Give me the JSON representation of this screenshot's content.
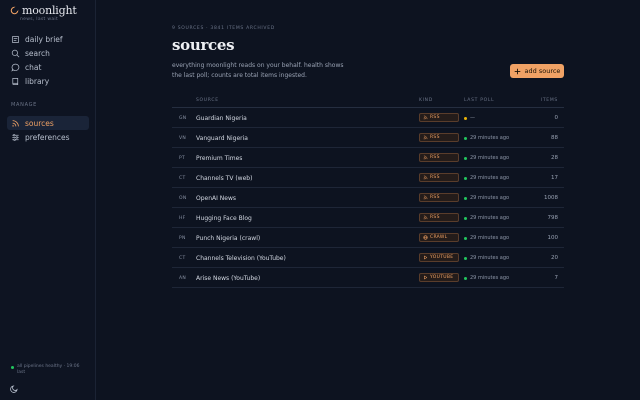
{
  "brand": {
    "name": "moonlight",
    "tagline": "news, last wait"
  },
  "nav": [
    {
      "label": "daily brief",
      "icon": "document-icon",
      "name": "daily-brief"
    },
    {
      "label": "search",
      "icon": "search-icon",
      "name": "search"
    },
    {
      "label": "chat",
      "icon": "chat-icon",
      "name": "chat"
    },
    {
      "label": "library",
      "icon": "book-icon",
      "name": "library"
    }
  ],
  "manage": {
    "label": "MANAGE",
    "items": [
      {
        "label": "sources",
        "icon": "rss-icon",
        "name": "sources",
        "active": true
      },
      {
        "label": "preferences",
        "icon": "sliders-icon",
        "name": "preferences",
        "active": false
      }
    ]
  },
  "status": {
    "text": "all pipelines healthy · 19:06 last"
  },
  "page": {
    "crumb": "9 SOURCES · 3841 ITEMS ARCHIVED",
    "title": "sources",
    "description": "everything moonlight reads on your behalf. health shows the last poll; counts are total items ingested.",
    "add_label": "add source"
  },
  "table": {
    "columns": {
      "source": "SOURCE",
      "kind": "KIND",
      "last_poll": "LAST POLL",
      "items": "ITEMS"
    },
    "rows": [
      {
        "abbr": "GN",
        "name": "Guardian Nigeria",
        "kind": "RSS",
        "kind_icon": "rss-icon",
        "poll": "—",
        "status": "pending",
        "items": "0"
      },
      {
        "abbr": "VN",
        "name": "Vanguard Nigeria",
        "kind": "RSS",
        "kind_icon": "rss-icon",
        "poll": "29 minutes ago",
        "status": "ok",
        "items": "88"
      },
      {
        "abbr": "PT",
        "name": "Premium Times",
        "kind": "RSS",
        "kind_icon": "rss-icon",
        "poll": "29 minutes ago",
        "status": "ok",
        "items": "28"
      },
      {
        "abbr": "CT",
        "name": "Channels TV (web)",
        "kind": "RSS",
        "kind_icon": "rss-icon",
        "poll": "29 minutes ago",
        "status": "ok",
        "items": "17"
      },
      {
        "abbr": "ON",
        "name": "OpenAI News",
        "kind": "RSS",
        "kind_icon": "rss-icon",
        "poll": "29 minutes ago",
        "status": "ok",
        "items": "1008"
      },
      {
        "abbr": "HF",
        "name": "Hugging Face Blog",
        "kind": "RSS",
        "kind_icon": "rss-icon",
        "poll": "29 minutes ago",
        "status": "ok",
        "items": "798"
      },
      {
        "abbr": "PN",
        "name": "Punch Nigeria (crawl)",
        "kind": "CRAWL",
        "kind_icon": "globe-icon",
        "poll": "29 minutes ago",
        "status": "ok",
        "items": "100"
      },
      {
        "abbr": "CT",
        "name": "Channels Television (YouTube)",
        "kind": "YOUTUBE",
        "kind_icon": "play-icon",
        "poll": "29 minutes ago",
        "status": "ok",
        "items": "20"
      },
      {
        "abbr": "AN",
        "name": "Arise News (YouTube)",
        "kind": "YOUTUBE",
        "kind_icon": "play-icon",
        "poll": "29 minutes ago",
        "status": "ok",
        "items": "7"
      }
    ]
  },
  "colors": {
    "accent": "#f0a265",
    "ok": "#22c55e",
    "pending": "#eab308",
    "background": "#0d1320"
  }
}
